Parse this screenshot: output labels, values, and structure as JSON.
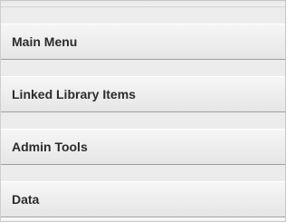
{
  "menu": {
    "items": [
      {
        "label": "Main Menu"
      },
      {
        "label": "Linked Library Items"
      },
      {
        "label": "Admin Tools"
      },
      {
        "label": "Data"
      }
    ]
  }
}
